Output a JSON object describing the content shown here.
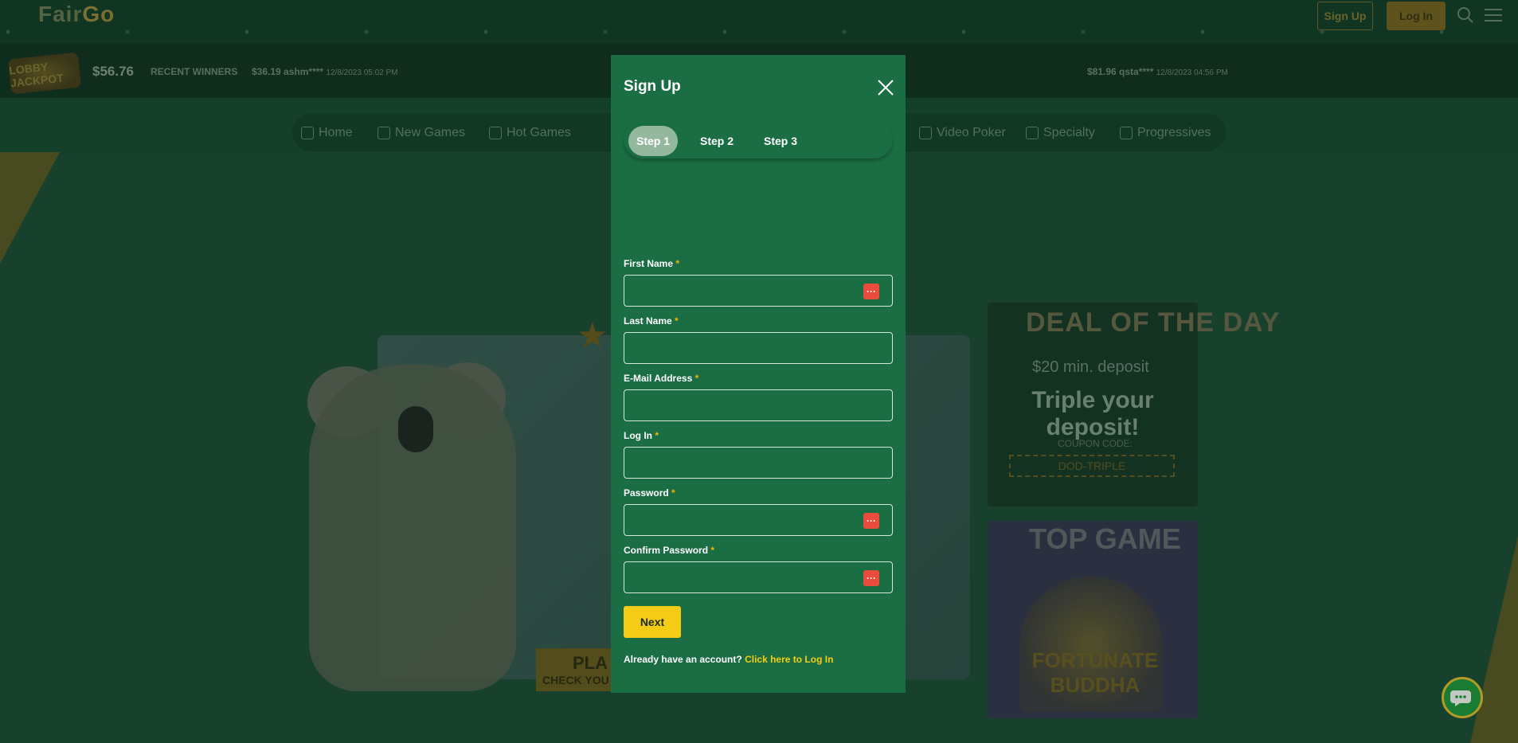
{
  "site": {
    "logo_left": "Fair",
    "logo_right": "Go",
    "signup_label": "Sign Up",
    "login_label": "Log In"
  },
  "winners_bar": {
    "jackpot_badge": "LOBBY JACKPOT",
    "jackpot_amount": "$56.76",
    "recent_label": "RECENT WINNERS",
    "items": [
      {
        "amount": "$36.19",
        "user": "ashm****",
        "date": "12/8/2023 05:02 PM"
      },
      {
        "amount": "$81.96",
        "user": "qsta****",
        "date": "12/8/2023 04:56 PM"
      }
    ]
  },
  "nav": {
    "items": [
      {
        "label": "Home"
      },
      {
        "label": "New Games"
      },
      {
        "label": "Hot Games"
      },
      {
        "label": "Video Poker"
      },
      {
        "label": "Specialty"
      },
      {
        "label": "Progressives"
      }
    ]
  },
  "hero": {
    "play_label": "PLA",
    "check_label": "CHECK YOU"
  },
  "deal_of_day": {
    "title": "DEAL OF THE DAY",
    "min_deposit": "$20 min. deposit",
    "headline": "Triple your deposit!",
    "coupon_label": "COUPON CODE:",
    "coupon_code": "DOD-TRIPLE"
  },
  "top_game": {
    "title": "TOP GAME",
    "game_name": "FORTUNATE BUDDHA"
  },
  "modal": {
    "title": "Sign Up",
    "steps": [
      {
        "label": "Step 1",
        "active": true
      },
      {
        "label": "Step 2",
        "active": false
      },
      {
        "label": "Step 3",
        "active": false
      }
    ],
    "fields": {
      "first_name": {
        "label": "First Name",
        "value": ""
      },
      "last_name": {
        "label": "Last Name",
        "value": ""
      },
      "email": {
        "label": "E-Mail Address",
        "value": ""
      },
      "login": {
        "label": "Log In",
        "value": ""
      },
      "password": {
        "label": "Password",
        "value": ""
      },
      "confirm_password": {
        "label": "Confirm Password",
        "value": ""
      }
    },
    "required_mark": "*",
    "next_label": "Next",
    "already_text": "Already have an account?",
    "login_link": "Click here to Log In"
  },
  "colors": {
    "modal_bg": "#1b6e43",
    "accent_yellow": "#f5cc15",
    "required": "#f5b400",
    "active_step": "#94b89e",
    "pw_icon": "#e74c3c"
  }
}
